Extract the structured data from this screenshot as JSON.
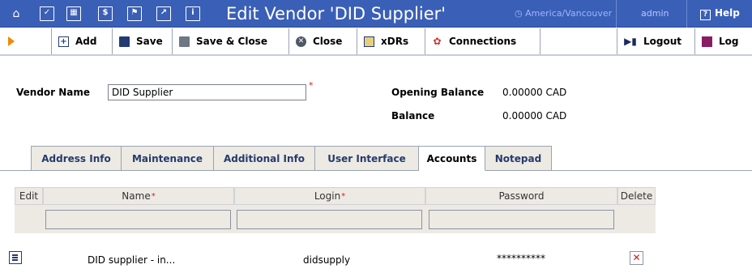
{
  "header": {
    "title": "Edit Vendor 'DID Supplier'",
    "timezone": "America/Vancouver",
    "user": "admin",
    "help_label": "Help"
  },
  "toolbar": {
    "add_label": "Add",
    "save_label": "Save",
    "save_close_label": "Save & Close",
    "close_label": "Close",
    "xdrs_label": "xDRs",
    "connections_label": "Connections",
    "logout_label": "Logout",
    "log_label": "Log"
  },
  "form": {
    "vendor_name_label": "Vendor Name",
    "vendor_name_value": "DID Supplier",
    "required_mark": "*",
    "opening_balance_label": "Opening Balance",
    "opening_balance_value": "0.00000 CAD",
    "balance_label": "Balance",
    "balance_value": "0.00000 CAD"
  },
  "tabs": [
    {
      "label": "Address Info",
      "active": false
    },
    {
      "label": "Maintenance",
      "active": false
    },
    {
      "label": "Additional Info",
      "active": false
    },
    {
      "label": "User Interface",
      "active": false
    },
    {
      "label": "Accounts",
      "active": true
    },
    {
      "label": "Notepad",
      "active": false
    }
  ],
  "accounts_table": {
    "columns": {
      "edit": "Edit",
      "name": "Name",
      "login": "Login",
      "password": "Password",
      "delete": "Delete"
    },
    "required_mark": "*",
    "rows": [
      {
        "name": "DID supplier - in...",
        "login": "didsupply",
        "password": "**********"
      }
    ]
  },
  "colors": {
    "header_bg": "#3a5fb6",
    "tab_bg": "#eceae3",
    "accent_orange": "#f08a00",
    "required_red": "#d02020"
  }
}
